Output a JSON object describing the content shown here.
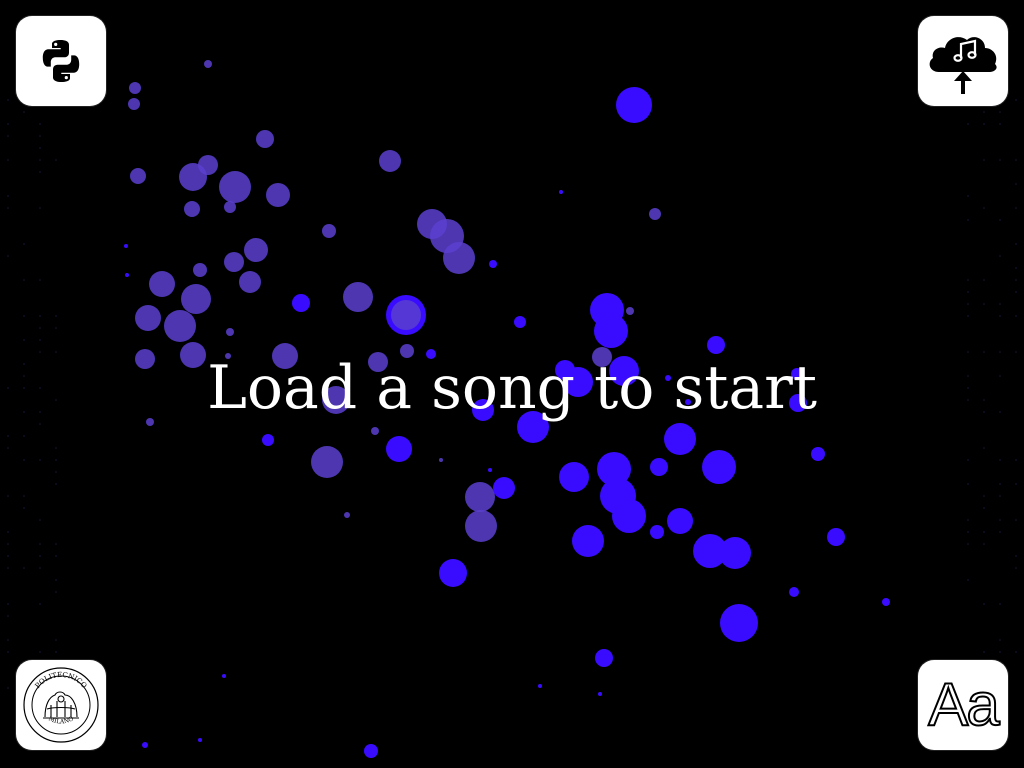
{
  "prompt": {
    "text": "Load a song to start"
  },
  "buttons": {
    "python": {
      "icon": "python-icon"
    },
    "upload": {
      "icon": "cloud-music-upload-icon"
    },
    "logo": {
      "icon": "politecnico-milano-seal-icon",
      "seal_text_top": "POLITECNICO",
      "seal_text_bottom": "MILANO"
    },
    "font": {
      "icon": "font-aa-icon",
      "label": "Aa"
    }
  },
  "colors": {
    "background": "#000000",
    "button_bg": "#ffffff",
    "particle_bright": "#3a0cff",
    "particle_muted": "#5b3fcf",
    "text": "#ffffff"
  }
}
